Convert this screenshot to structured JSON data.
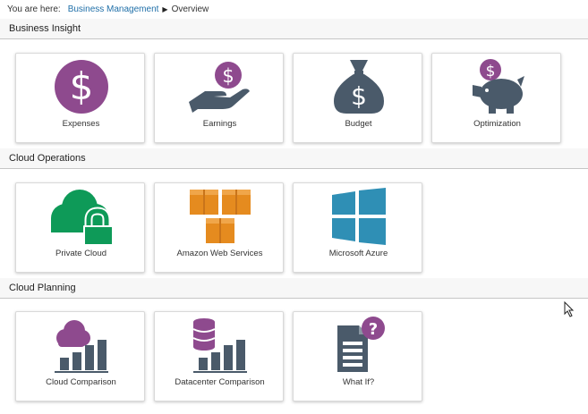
{
  "breadcrumb": {
    "lead": "You are here:",
    "parent": "Business Management",
    "separator": "▶",
    "current": "Overview"
  },
  "colors": {
    "purple": "#8e4a8e",
    "slate": "#4a5a6a",
    "green": "#0e9a58",
    "orange": "#e58b1f",
    "blue": "#2f8fb5",
    "link": "#1f6fa8"
  },
  "sections": [
    {
      "title": "Business Insight",
      "tiles": [
        {
          "label": "Expenses",
          "icon": "dollar-circle-icon"
        },
        {
          "label": "Earnings",
          "icon": "hand-holding-dollar-icon"
        },
        {
          "label": "Budget",
          "icon": "money-bag-icon"
        },
        {
          "label": "Optimization",
          "icon": "piggy-bank-icon"
        }
      ]
    },
    {
      "title": "Cloud Operations",
      "tiles": [
        {
          "label": "Private Cloud",
          "icon": "cloud-lock-icon"
        },
        {
          "label": "Amazon Web Services",
          "icon": "aws-boxes-icon"
        },
        {
          "label": "Microsoft Azure",
          "icon": "windows-logo-icon"
        }
      ]
    },
    {
      "title": "Cloud Planning",
      "tiles": [
        {
          "label": "Cloud Comparison",
          "icon": "cloud-bar-chart-icon"
        },
        {
          "label": "Datacenter Comparison",
          "icon": "database-bar-chart-icon"
        },
        {
          "label": "What If?",
          "icon": "document-question-icon"
        }
      ]
    }
  ]
}
